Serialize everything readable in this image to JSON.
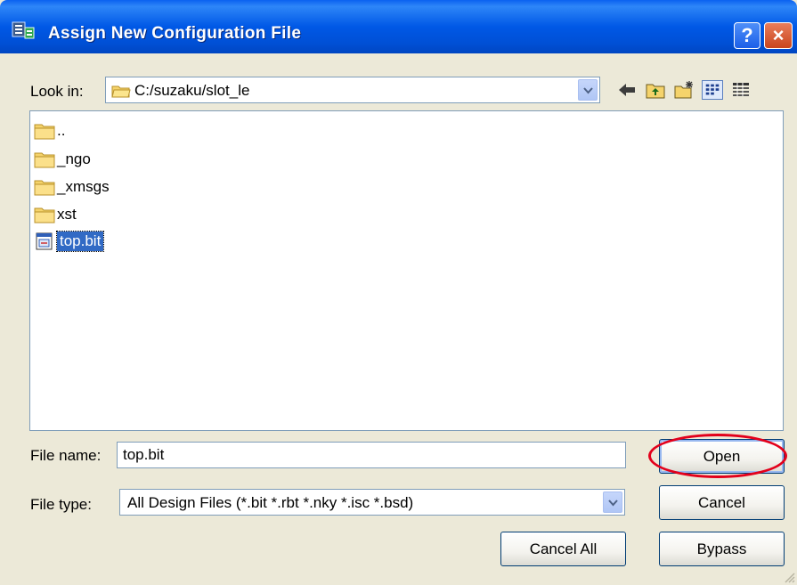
{
  "window": {
    "title": "Assign New Configuration File",
    "help_label": "?",
    "close_label": "×"
  },
  "look_in": {
    "label": "Look in:",
    "value": "C:/suzaku/slot_le"
  },
  "files": [
    {
      "name": "..",
      "type": "folder"
    },
    {
      "name": "_ngo",
      "type": "folder"
    },
    {
      "name": "_xmsgs",
      "type": "folder"
    },
    {
      "name": "xst",
      "type": "folder"
    },
    {
      "name": "top.bit",
      "type": "bit-file",
      "selected": true
    }
  ],
  "file_name": {
    "label": "File name:",
    "value": "top.bit"
  },
  "file_type": {
    "label": "File type:",
    "value": "All Design Files (*.bit *.rbt *.nky *.isc *.bsd)"
  },
  "buttons": {
    "open": "Open",
    "cancel": "Cancel",
    "cancel_all": "Cancel All",
    "bypass": "Bypass"
  },
  "colors": {
    "title_bar": "#0058e6",
    "selection": "#316ac5",
    "highlight_ring": "#e3001b",
    "dialog_bg": "#ece9d8"
  }
}
